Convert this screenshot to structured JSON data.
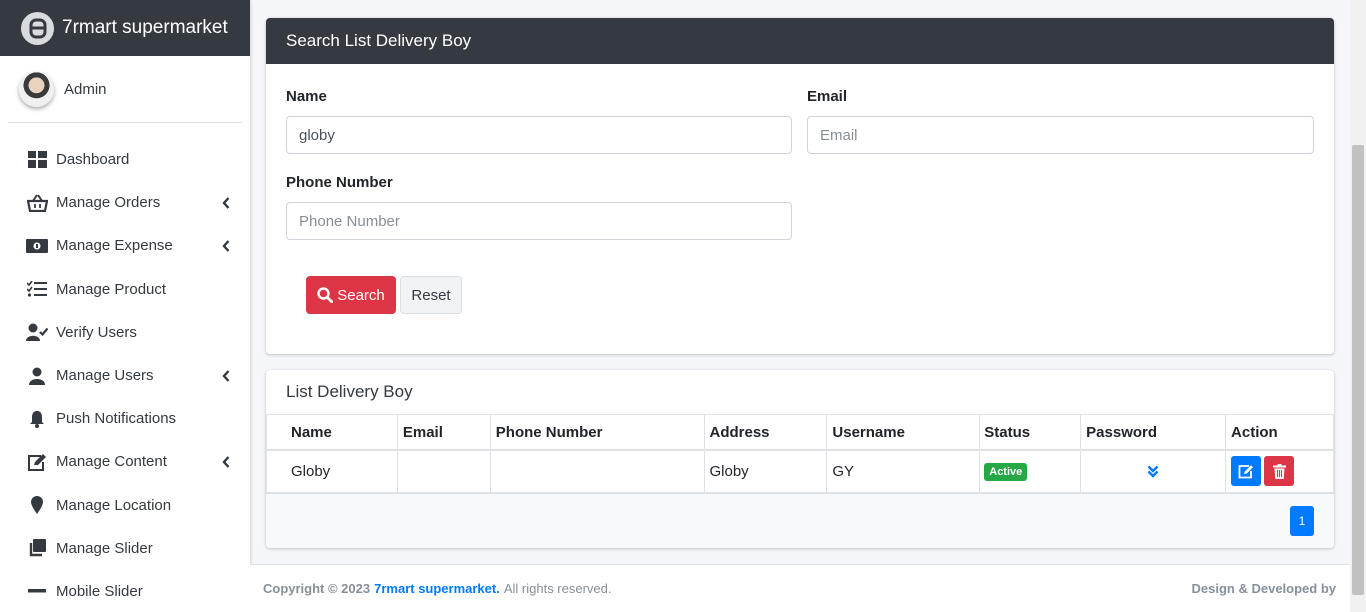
{
  "brand": {
    "name": "7rmart supermarket"
  },
  "user": {
    "name": "Admin"
  },
  "sidebar": {
    "items": [
      {
        "label": "Dashboard",
        "icon": "dashboard-icon",
        "has_children": false
      },
      {
        "label": "Manage Orders",
        "icon": "basket-icon",
        "has_children": true
      },
      {
        "label": "Manage Expense",
        "icon": "money-icon",
        "has_children": true
      },
      {
        "label": "Manage Product",
        "icon": "list-check-icon",
        "has_children": false
      },
      {
        "label": "Verify Users",
        "icon": "user-check-icon",
        "has_children": false
      },
      {
        "label": "Manage Users",
        "icon": "user-icon",
        "has_children": true
      },
      {
        "label": "Push Notifications",
        "icon": "bell-icon",
        "has_children": false
      },
      {
        "label": "Manage Content",
        "icon": "edit-icon",
        "has_children": true
      },
      {
        "label": "Manage Location",
        "icon": "map-marker-icon",
        "has_children": false
      },
      {
        "label": "Manage Slider",
        "icon": "clone-icon",
        "has_children": false
      },
      {
        "label": "Mobile Slider",
        "icon": "minus-icon",
        "has_children": false
      }
    ]
  },
  "search_card": {
    "title": "Search List Delivery Boy",
    "name_label": "Name",
    "name_value": "globy",
    "email_label": "Email",
    "email_placeholder": "Email",
    "phone_label": "Phone Number",
    "phone_placeholder": "Phone Number",
    "search_button": "Search",
    "reset_button": "Reset"
  },
  "list_card": {
    "title": "List Delivery Boy",
    "columns": [
      "Name",
      "Email",
      "Phone Number",
      "Address",
      "Username",
      "Status",
      "Password",
      "Action"
    ],
    "rows": [
      {
        "name": "Globy",
        "email": "",
        "phone": "",
        "address": "Globy",
        "username": "GY",
        "status": "Active"
      }
    ],
    "current_page": "1"
  },
  "footer": {
    "copyright_prefix": "Copyright © 2023",
    "brand_link": "7rmart supermarket.",
    "rights": "All rights reserved.",
    "right_text": "Design & Developed by"
  },
  "colors": {
    "dark": "#343a40",
    "primary": "#007bff",
    "danger": "#dc3545",
    "success": "#28a745"
  }
}
